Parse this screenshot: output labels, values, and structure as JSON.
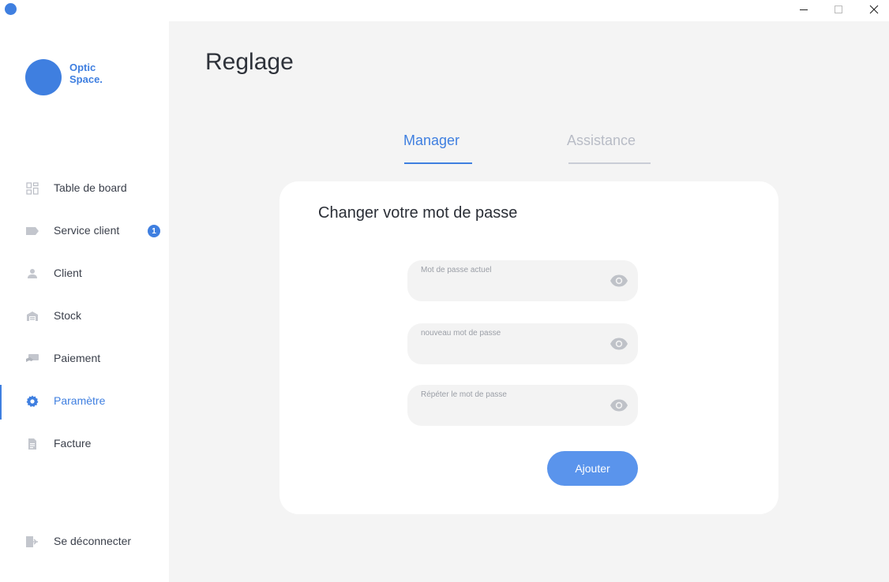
{
  "window": {
    "minimize_icon": "minimize-icon",
    "maximize_icon": "maximize-icon",
    "close_icon": "close-icon"
  },
  "brand": {
    "line1": "Optic",
    "line2": "Space.",
    "color": "#3f7fe0"
  },
  "sidebar": {
    "items": [
      {
        "label": "Table de board",
        "icon": "dashboard-icon"
      },
      {
        "label": "Service client",
        "icon": "tag-icon",
        "badge": "1"
      },
      {
        "label": "Client",
        "icon": "person-icon"
      },
      {
        "label": "Stock",
        "icon": "warehouse-icon"
      },
      {
        "label": "Paiement",
        "icon": "payment-icon"
      },
      {
        "label": "Paramètre",
        "icon": "gear-icon",
        "active": true
      },
      {
        "label": "Facture",
        "icon": "invoice-icon"
      }
    ],
    "logout": {
      "label": "Se déconnecter",
      "icon": "logout-icon"
    }
  },
  "main": {
    "title": "Reglage",
    "tabs": [
      {
        "label": "Manager",
        "active": true
      },
      {
        "label": "Assistance",
        "active": false
      }
    ],
    "card": {
      "title": "Changer votre mot de passe",
      "fields": [
        {
          "label": "Mot de passe actuel",
          "value": ""
        },
        {
          "label": "nouveau mot de passe",
          "value": ""
        },
        {
          "label": "Répéter le mot de passe",
          "value": ""
        }
      ],
      "submit_label": "Ajouter"
    }
  },
  "colors": {
    "accent": "#3f7fe0",
    "button": "#5a94ec",
    "inactive_tab": "#b8bcc6",
    "background": "#f4f4f4"
  }
}
